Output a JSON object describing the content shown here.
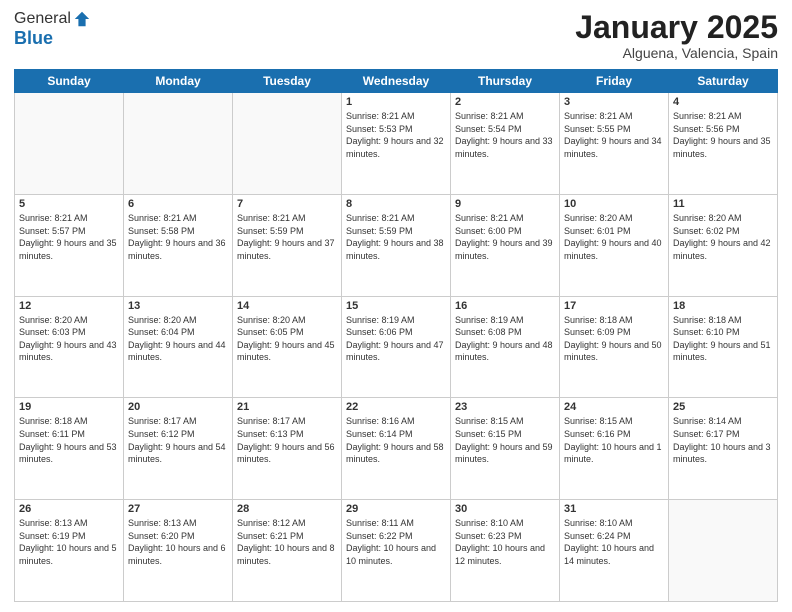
{
  "logo": {
    "line1": "General",
    "line2": "Blue"
  },
  "title": "January 2025",
  "subtitle": "Alguena, Valencia, Spain",
  "weekdays": [
    "Sunday",
    "Monday",
    "Tuesday",
    "Wednesday",
    "Thursday",
    "Friday",
    "Saturday"
  ],
  "weeks": [
    [
      {
        "day": "",
        "info": ""
      },
      {
        "day": "",
        "info": ""
      },
      {
        "day": "",
        "info": ""
      },
      {
        "day": "1",
        "info": "Sunrise: 8:21 AM\nSunset: 5:53 PM\nDaylight: 9 hours and 32 minutes."
      },
      {
        "day": "2",
        "info": "Sunrise: 8:21 AM\nSunset: 5:54 PM\nDaylight: 9 hours and 33 minutes."
      },
      {
        "day": "3",
        "info": "Sunrise: 8:21 AM\nSunset: 5:55 PM\nDaylight: 9 hours and 34 minutes."
      },
      {
        "day": "4",
        "info": "Sunrise: 8:21 AM\nSunset: 5:56 PM\nDaylight: 9 hours and 35 minutes."
      }
    ],
    [
      {
        "day": "5",
        "info": "Sunrise: 8:21 AM\nSunset: 5:57 PM\nDaylight: 9 hours and 35 minutes."
      },
      {
        "day": "6",
        "info": "Sunrise: 8:21 AM\nSunset: 5:58 PM\nDaylight: 9 hours and 36 minutes."
      },
      {
        "day": "7",
        "info": "Sunrise: 8:21 AM\nSunset: 5:59 PM\nDaylight: 9 hours and 37 minutes."
      },
      {
        "day": "8",
        "info": "Sunrise: 8:21 AM\nSunset: 5:59 PM\nDaylight: 9 hours and 38 minutes."
      },
      {
        "day": "9",
        "info": "Sunrise: 8:21 AM\nSunset: 6:00 PM\nDaylight: 9 hours and 39 minutes."
      },
      {
        "day": "10",
        "info": "Sunrise: 8:20 AM\nSunset: 6:01 PM\nDaylight: 9 hours and 40 minutes."
      },
      {
        "day": "11",
        "info": "Sunrise: 8:20 AM\nSunset: 6:02 PM\nDaylight: 9 hours and 42 minutes."
      }
    ],
    [
      {
        "day": "12",
        "info": "Sunrise: 8:20 AM\nSunset: 6:03 PM\nDaylight: 9 hours and 43 minutes."
      },
      {
        "day": "13",
        "info": "Sunrise: 8:20 AM\nSunset: 6:04 PM\nDaylight: 9 hours and 44 minutes."
      },
      {
        "day": "14",
        "info": "Sunrise: 8:20 AM\nSunset: 6:05 PM\nDaylight: 9 hours and 45 minutes."
      },
      {
        "day": "15",
        "info": "Sunrise: 8:19 AM\nSunset: 6:06 PM\nDaylight: 9 hours and 47 minutes."
      },
      {
        "day": "16",
        "info": "Sunrise: 8:19 AM\nSunset: 6:08 PM\nDaylight: 9 hours and 48 minutes."
      },
      {
        "day": "17",
        "info": "Sunrise: 8:18 AM\nSunset: 6:09 PM\nDaylight: 9 hours and 50 minutes."
      },
      {
        "day": "18",
        "info": "Sunrise: 8:18 AM\nSunset: 6:10 PM\nDaylight: 9 hours and 51 minutes."
      }
    ],
    [
      {
        "day": "19",
        "info": "Sunrise: 8:18 AM\nSunset: 6:11 PM\nDaylight: 9 hours and 53 minutes."
      },
      {
        "day": "20",
        "info": "Sunrise: 8:17 AM\nSunset: 6:12 PM\nDaylight: 9 hours and 54 minutes."
      },
      {
        "day": "21",
        "info": "Sunrise: 8:17 AM\nSunset: 6:13 PM\nDaylight: 9 hours and 56 minutes."
      },
      {
        "day": "22",
        "info": "Sunrise: 8:16 AM\nSunset: 6:14 PM\nDaylight: 9 hours and 58 minutes."
      },
      {
        "day": "23",
        "info": "Sunrise: 8:15 AM\nSunset: 6:15 PM\nDaylight: 9 hours and 59 minutes."
      },
      {
        "day": "24",
        "info": "Sunrise: 8:15 AM\nSunset: 6:16 PM\nDaylight: 10 hours and 1 minute."
      },
      {
        "day": "25",
        "info": "Sunrise: 8:14 AM\nSunset: 6:17 PM\nDaylight: 10 hours and 3 minutes."
      }
    ],
    [
      {
        "day": "26",
        "info": "Sunrise: 8:13 AM\nSunset: 6:19 PM\nDaylight: 10 hours and 5 minutes."
      },
      {
        "day": "27",
        "info": "Sunrise: 8:13 AM\nSunset: 6:20 PM\nDaylight: 10 hours and 6 minutes."
      },
      {
        "day": "28",
        "info": "Sunrise: 8:12 AM\nSunset: 6:21 PM\nDaylight: 10 hours and 8 minutes."
      },
      {
        "day": "29",
        "info": "Sunrise: 8:11 AM\nSunset: 6:22 PM\nDaylight: 10 hours and 10 minutes."
      },
      {
        "day": "30",
        "info": "Sunrise: 8:10 AM\nSunset: 6:23 PM\nDaylight: 10 hours and 12 minutes."
      },
      {
        "day": "31",
        "info": "Sunrise: 8:10 AM\nSunset: 6:24 PM\nDaylight: 10 hours and 14 minutes."
      },
      {
        "day": "",
        "info": ""
      }
    ]
  ]
}
